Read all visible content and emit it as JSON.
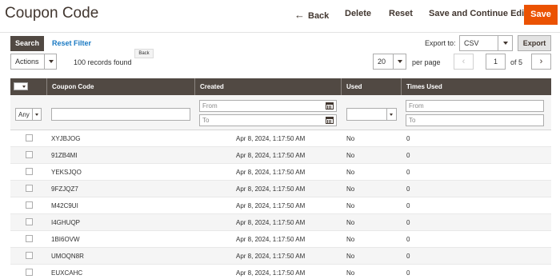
{
  "header": {
    "title": "Coupon Code",
    "back_label": "Back",
    "delete_label": "Delete",
    "reset_label": "Reset",
    "save_continue_label": "Save and Continue Edit",
    "save_label": "Save"
  },
  "toolbar": {
    "search_label": "Search",
    "reset_filter_label": "Reset Filter",
    "tooltip_text": "Back",
    "export_label": "Export to:",
    "export_format": "CSV",
    "export_button": "Export",
    "actions_label": "Actions",
    "records_found": "100 records found",
    "per_page_value": "20",
    "per_page_label": "per page",
    "current_page": "1",
    "page_of": "of 5"
  },
  "grid": {
    "columns": {
      "code": "Coupon Code",
      "created": "Created",
      "used": "Used",
      "times_used": "Times Used"
    },
    "filters": {
      "mass_select": "Any",
      "from_placeholder": "From",
      "to_placeholder": "To"
    },
    "rows": [
      {
        "code": "XYJBJOG",
        "created": "Apr 8, 2024, 1:17:50 AM",
        "used": "No",
        "times_used": "0"
      },
      {
        "code": "91ZB4MI",
        "created": "Apr 8, 2024, 1:17:50 AM",
        "used": "No",
        "times_used": "0"
      },
      {
        "code": "YEKSJQO",
        "created": "Apr 8, 2024, 1:17:50 AM",
        "used": "No",
        "times_used": "0"
      },
      {
        "code": "9FZJQZ7",
        "created": "Apr 8, 2024, 1:17:50 AM",
        "used": "No",
        "times_used": "0"
      },
      {
        "code": "M42C9UI",
        "created": "Apr 8, 2024, 1:17:50 AM",
        "used": "No",
        "times_used": "0"
      },
      {
        "code": "I4GHUQP",
        "created": "Apr 8, 2024, 1:17:50 AM",
        "used": "No",
        "times_used": "0"
      },
      {
        "code": "1BI6OVW",
        "created": "Apr 8, 2024, 1:17:50 AM",
        "used": "No",
        "times_used": "0"
      },
      {
        "code": "UMOQN8R",
        "created": "Apr 8, 2024, 1:17:50 AM",
        "used": "No",
        "times_used": "0"
      },
      {
        "code": "EUXCAHC",
        "created": "Apr 8, 2024, 1:17:50 AM",
        "used": "No",
        "times_used": "0"
      }
    ]
  },
  "colors": {
    "primary_button": "#eb5202",
    "grid_header": "#514943",
    "link": "#1979c3"
  }
}
